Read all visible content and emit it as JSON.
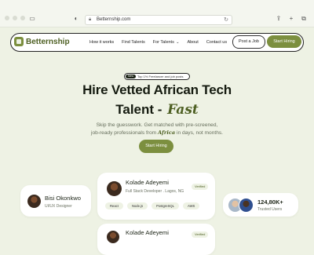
{
  "browser": {
    "url": "Betternship.com"
  },
  "nav": {
    "brand": "Betternship",
    "links": [
      "How it works",
      "Find Talents",
      "For Talents",
      "About",
      "Contact us"
    ],
    "post_job_label": "Post a Job",
    "start_hiring_label": "Start Hiring"
  },
  "hero": {
    "badge_new": "New",
    "badge_text": "Top 1% Freelancer and job posts",
    "title_line1": "Hire Vetted African Tech",
    "title_line2": "Talent -",
    "title_accent": "Fast",
    "subtitle_part1": "Skip the guesswork. Get matched with pre-screened,",
    "subtitle_part2": "job-ready professionals from",
    "subtitle_accent": "Africa",
    "subtitle_part3": "in days, not months.",
    "cta_label": "Start Hiring"
  },
  "cards": {
    "left": {
      "name": "Bisi Okonkwo",
      "role": "UI/UX Designer"
    },
    "main": {
      "name": "Kolade Adeyemi",
      "role": "Full Stack Developer . Lagos, NG",
      "badge": "Verified",
      "skills": [
        "React",
        "Node.js",
        "PostgreSQL",
        "AWS"
      ]
    },
    "stats": {
      "value": "124,80K+",
      "label": "Trusted Users"
    },
    "bottom": {
      "name": "Kolade Adeyemi",
      "badge": "Verified"
    }
  },
  "colors": {
    "accent": "#7c8f3f",
    "brand_dark": "#4d5f22",
    "background": "#eef2e4"
  }
}
